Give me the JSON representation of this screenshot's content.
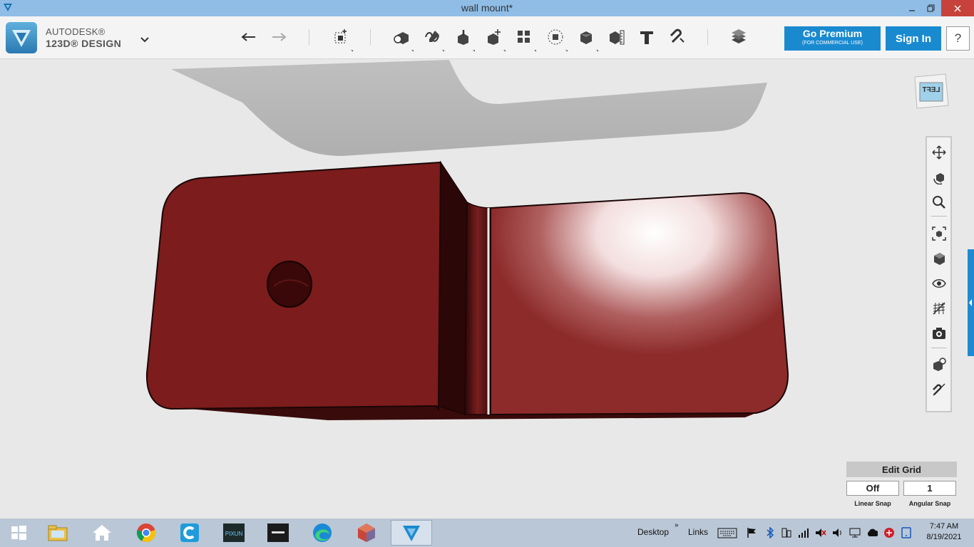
{
  "window": {
    "title": "wall mount*",
    "app_icon": "123d-logo-icon",
    "controls": [
      "minimize-icon",
      "restore-icon",
      "close-icon"
    ]
  },
  "brand": {
    "line1": "AUTODESK®",
    "line2": "123D® DESIGN",
    "menu_icon": "chevron-down-icon"
  },
  "toolbar": {
    "tools": [
      "undo-icon",
      "redo-icon",
      "transform-icon",
      "primitives-icon",
      "sketch-icon",
      "construct-icon",
      "modify-icon",
      "pattern-icon",
      "grouping-icon",
      "combine-icon",
      "measure-icon",
      "text-icon",
      "snap-icon",
      "material-icon"
    ],
    "premium_label": "Go Premium",
    "premium_sub": "(FOR COMMERCIAL USE)",
    "signin_label": "Sign In",
    "help_label": "?"
  },
  "viewcube": {
    "face_label": "LEFT"
  },
  "nav_tools": [
    "pan-icon",
    "orbit-icon",
    "zoom-icon",
    "fit-icon",
    "view-mode-icon",
    "visibility-icon",
    "grid-material-icon",
    "screenshot-icon",
    "select-mode-icon",
    "hide-snap-icon"
  ],
  "grid_panel": {
    "title": "Edit Grid",
    "linear_snap_value": "Off",
    "angular_snap_value": "1",
    "linear_snap_label": "Linear Snap",
    "angular_snap_label": "Angular Snap"
  },
  "colors": {
    "model": "#7c1c1c",
    "model_dark": "#3a0b0b",
    "accent_blue": "#1a8ad0",
    "titlebar": "#8fbde6"
  },
  "taskbar": {
    "apps": [
      "windows-start-icon",
      "file-explorer-icon",
      "home-icon",
      "chrome-icon",
      "c-app-icon",
      "pixun-app-icon",
      "dark-app-icon",
      "edge-icon",
      "cube-app-icon",
      "123d-app-icon"
    ],
    "desktop_label": "Desktop",
    "links_label": "Links",
    "tray_icons": [
      "keyboard-icon",
      "flag-icon",
      "bluetooth-icon",
      "network-icon",
      "signal-icon",
      "volume-mute-icon",
      "speaker-icon",
      "display-icon",
      "cloud-icon",
      "red-app-icon",
      "tablet-icon"
    ],
    "time": "7:47 AM",
    "date": "8/19/2021"
  }
}
